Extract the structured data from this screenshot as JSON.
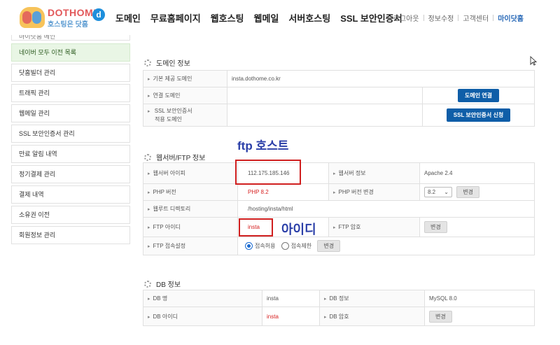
{
  "header": {
    "logo_title": "DOTHOME",
    "logo_sub": "호스팅은 닷홈",
    "logo_mark": "d",
    "nav": [
      "도메인",
      "무료홈페이지",
      "웹호스팅",
      "웹메일",
      "서버호스팅",
      "SSL 보안인증서"
    ],
    "util": [
      "로그아웃",
      "정보수정",
      "고객센터",
      "마이닷홈"
    ]
  },
  "sidebar": {
    "cut_item": "마이닷홈 메인",
    "items": [
      "네이버 모두 이전 목록",
      "닷홈빌더 관리",
      "트래픽 관리",
      "웹메일 관리",
      "SSL 보안인증서 관리",
      "만료 알림 내역",
      "정기결제 관리",
      "결제 내역",
      "소유권 이전",
      "회원정보 관리"
    ]
  },
  "domain": {
    "title": "도메인 정보",
    "rows": [
      {
        "label": "기본 제공 도메인",
        "value": "insta.dothome.co.kr"
      },
      {
        "label": "연결 도메인",
        "button": "도메인 연결"
      },
      {
        "label1": "SSL 보안인증서",
        "label2": "적용 도메인",
        "button": "SSL 보안인증서 신청"
      }
    ]
  },
  "web": {
    "title": "웹서버/FTP 정보",
    "server_ip_label": "웹서버 아이피",
    "server_ip": "112.175.185.146",
    "server_info_label": "웹서버 정보",
    "server_info": "Apache 2.4",
    "php_label": "PHP 버전",
    "php_value": "PHP 8.2",
    "php_change_label": "PHP 버전 변경",
    "php_select": "8.2",
    "change_btn": "변경",
    "root_label": "웹루트 디렉토리",
    "root_value": "/hosting/insta/html",
    "ftp_id_label": "FTP 아이디",
    "ftp_id": "insta",
    "ftp_pw_label": "FTP 암호",
    "ftp_access_label": "FTP 접속설정",
    "allow": "접속허용",
    "deny": "접속제한"
  },
  "db": {
    "title": "DB 정보",
    "name_label": "DB 명",
    "name": "insta",
    "info_label": "DB 정보",
    "info": "MySQL 8.0",
    "id_label": "DB 아이디",
    "id": "insta",
    "pw_label": "DB 암호",
    "change_btn": "변경"
  },
  "annotations": {
    "ftp_host": "ftp 호스트",
    "user_id": "아이디"
  },
  "colors": {
    "accent_blue": "#0f5ea8",
    "annotation_blue": "#2b3fa8",
    "highlight_red": "#d01f1f",
    "active_green": "#e9f6e5"
  }
}
